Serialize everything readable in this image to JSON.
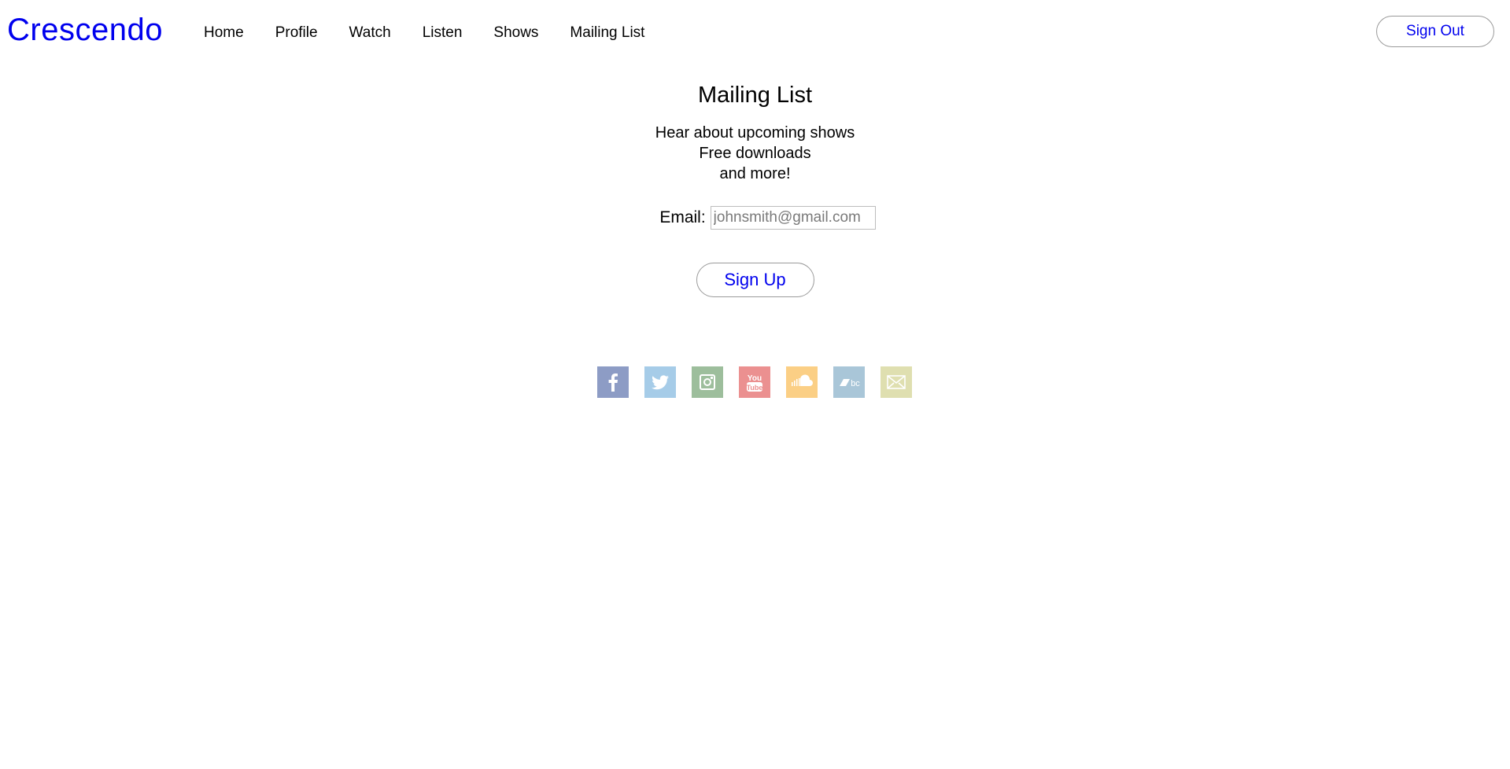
{
  "header": {
    "brand": "Crescendo",
    "nav": [
      {
        "label": "Home"
      },
      {
        "label": "Profile"
      },
      {
        "label": "Watch"
      },
      {
        "label": "Listen"
      },
      {
        "label": "Shows"
      },
      {
        "label": "Mailing List"
      }
    ],
    "signout_label": "Sign Out"
  },
  "main": {
    "title": "Mailing List",
    "lines": [
      "Hear about upcoming shows",
      "Free downloads",
      "and more!"
    ],
    "email_label": "Email:",
    "email_placeholder": "johnsmith@gmail.com",
    "email_value": "",
    "signup_label": "Sign Up"
  },
  "social": [
    {
      "icon": "facebook-icon",
      "color": "#8d9cc5"
    },
    {
      "icon": "twitter-icon",
      "color": "#a6cce8"
    },
    {
      "icon": "instagram-icon",
      "color": "#9dbe9c"
    },
    {
      "icon": "youtube-icon",
      "color": "#eb9090"
    },
    {
      "icon": "soundcloud-icon",
      "color": "#fbcf85"
    },
    {
      "icon": "bandcamp-icon",
      "color": "#a9c6d8"
    },
    {
      "icon": "mail-icon",
      "color": "#dfdfb0"
    }
  ],
  "colors": {
    "link": "#0000ee",
    "text": "#000000",
    "border": "#9a9a9a"
  }
}
